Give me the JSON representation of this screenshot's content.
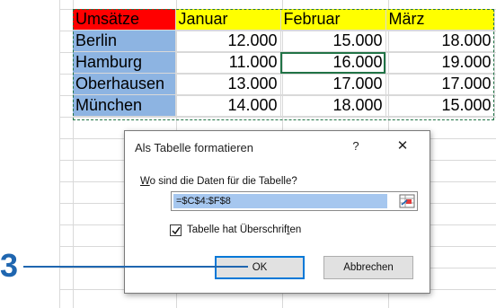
{
  "sheet": {
    "header": [
      "Umsätze",
      "Januar",
      "Februar",
      "März"
    ],
    "rows": [
      {
        "city": "Berlin",
        "values": [
          "12.000",
          "15.000",
          "18.000"
        ]
      },
      {
        "city": "Hamburg",
        "values": [
          "11.000",
          "16.000",
          "19.000"
        ]
      },
      {
        "city": "Oberhausen",
        "values": [
          "13.000",
          "17.000",
          "17.000"
        ]
      },
      {
        "city": "München",
        "values": [
          "14.000",
          "18.000",
          "15.000"
        ]
      }
    ],
    "colors": {
      "header_corner": "#ff0000",
      "header_months": "#ffff00",
      "city_cells": "#8db4e2",
      "selection": "#217346"
    }
  },
  "dialog": {
    "title": "Als Tabelle formatieren",
    "help": "?",
    "close": "✕",
    "prompt_access_key": "W",
    "prompt_rest": "o sind die Daten für die Tabelle?",
    "range_value": "=$C$4:$F$8",
    "checkbox_checked": true,
    "checkbox_label_main": "Tabelle hat Überschrif",
    "checkbox_label_key": "t",
    "checkbox_label_end": "en",
    "ok_label": "OK",
    "cancel_label": "Abbrechen"
  },
  "callout": {
    "number": "3",
    "color": "#1f66b0"
  }
}
